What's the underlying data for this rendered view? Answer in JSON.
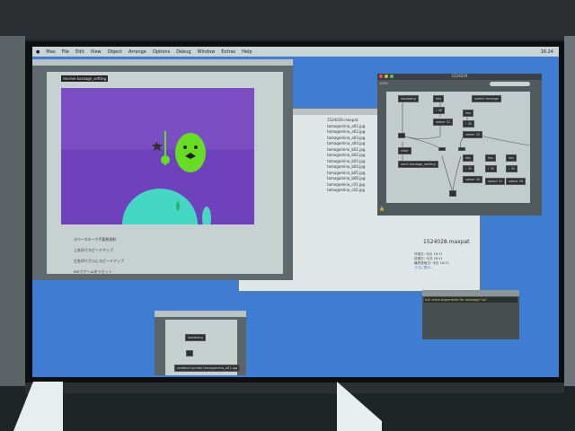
{
  "menubar": {
    "items": [
      "Max",
      "File",
      "Edit",
      "View",
      "Object",
      "Arrange",
      "Options",
      "Debug",
      "Window",
      "Extras",
      "Help"
    ],
    "clock": "16:24"
  },
  "presentation": {
    "object_label": "receive karaage_setting",
    "instructions": [
      "スペースキーで手裏剣投射",
      "上矢印でスピードアップ",
      "左矢印でさらにスピードアップ",
      "escでゲームをリセット"
    ]
  },
  "finder": {
    "files": [
      "1524028.maxpat",
      "tamagomina_a01.jpg",
      "tamagomina_a02.jpg",
      "tamagomina_a03.jpg",
      "tamagomina_a04.jpg",
      "tamagomina_b01.jpg",
      "tamagomina_b02.jpg",
      "tamagomina_b03.jpg",
      "tamagomina_b04.jpg",
      "tamagomina_b05.jpg",
      "tamagomina_b06.jpg",
      "tamagomina_c01.jpg",
      "tamagomina_c02.jpg"
    ],
    "preview_title": "1524028.maxpat",
    "info": [
      "作成日: 今日 16:11",
      "変更日: 今日 16:11",
      "最終使用日: 今日 16:11"
    ],
    "more": "さらに表示..."
  },
  "patcher": {
    "title": "1524028",
    "zoom": "100%",
    "objects": [
      "loadbang",
      "key",
      "switch karaage",
      "! 30",
      "select 31",
      "key",
      "! 30",
      "select 32",
      "clear",
      "send karaage_setting",
      "key",
      "key",
      "key",
      "! 30",
      "! 30",
      "! 30",
      "select 30",
      "select 31",
      "select 28"
    ]
  },
  "console": {
    "message": "tut: extra arguments for message \"ss\""
  },
  "small_window": {
    "objects": [
      "loadbang",
      "readout symbol tamagomina_a01.jpg"
    ]
  },
  "colors": {
    "desktop": "#3e7dd2",
    "canvas": "#7b4ec4",
    "character": "#66dd22",
    "whale": "#44d8c4"
  }
}
